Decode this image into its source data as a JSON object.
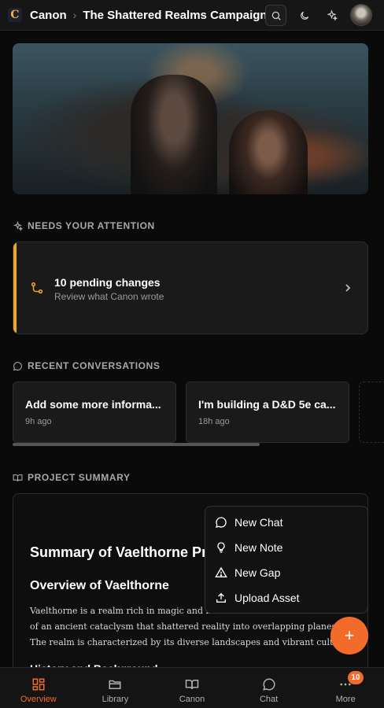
{
  "header": {
    "logo_letter": "C",
    "brand": "Canon",
    "project_title": "The Shattered Realms Campaign",
    "icons": [
      "search-icon",
      "moon-icon",
      "sparkles-icon",
      "avatar"
    ]
  },
  "attention": {
    "section_label": "NEEDS YOUR ATTENTION",
    "card_title": "10 pending changes",
    "card_subtitle": "Review what Canon wrote",
    "accent_color": "#f5a623"
  },
  "conversations": {
    "section_label": "RECENT CONVERSATIONS",
    "items": [
      {
        "title": "Add some more informa...",
        "date": "9h ago"
      },
      {
        "title": "I'm building a D&D 5e ca...",
        "date": "18h ago"
      }
    ]
  },
  "summary": {
    "section_label": "PROJECT SUMMARY",
    "heading": "Summary of Vaelthorne Pro",
    "subheading": "Overview of Vaelthorne",
    "paragraph_lines": [
      "Vaelthorne is a realm rich in magic and m",
      "of an ancient cataclysm that shattered reality into overlapping planes",
      "The realm is characterized by its diverse landscapes and vibrant cultur"
    ],
    "next_heading": "History and Background"
  },
  "menu": {
    "items": [
      {
        "label": "New Chat",
        "icon": "chat-bubble-icon"
      },
      {
        "label": "New Note",
        "icon": "lightbulb-icon"
      },
      {
        "label": "New Gap",
        "icon": "warning-triangle-icon"
      },
      {
        "label": "Upload Asset",
        "icon": "upload-icon"
      }
    ]
  },
  "fab": {
    "label": "+"
  },
  "bottom_nav": {
    "items": [
      {
        "label": "Overview",
        "icon": "grid-icon",
        "active": true
      },
      {
        "label": "Library",
        "icon": "folder-icon"
      },
      {
        "label": "Canon",
        "icon": "book-icon"
      },
      {
        "label": "Chat",
        "icon": "chat-icon"
      },
      {
        "label": "More",
        "icon": "more-icon",
        "badge": "10"
      }
    ]
  },
  "colors": {
    "accent": "#f26b2a",
    "attention": "#f5a623"
  }
}
